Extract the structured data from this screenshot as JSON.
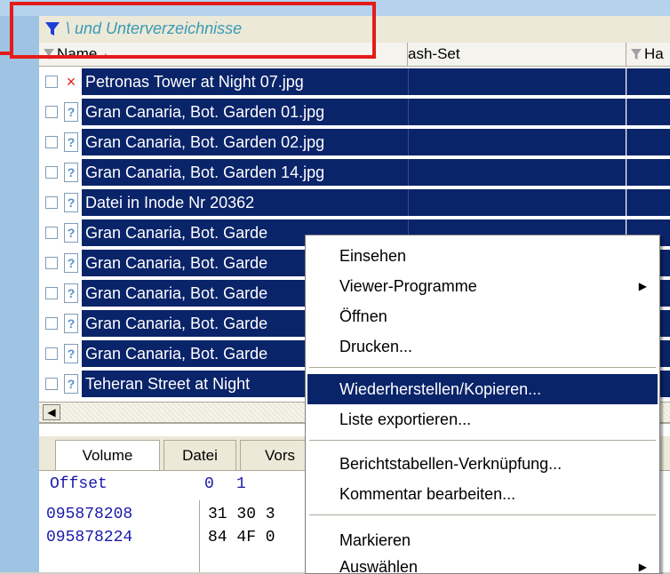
{
  "filter_bar": {
    "text": "\\ und Unterverzeichnisse"
  },
  "columns": {
    "name": "Name",
    "hash_set": "ash-Set",
    "hash": "Ha"
  },
  "rows": [
    {
      "name": "Petronas Tower at Night 07.jpg",
      "icon": "deleted-x-icon",
      "glyph": "×"
    },
    {
      "name": "Gran Canaria, Bot. Garden 01.jpg",
      "icon": "unknown-file-icon",
      "glyph": "?"
    },
    {
      "name": "Gran Canaria, Bot. Garden 02.jpg",
      "icon": "unknown-file-icon",
      "glyph": "?"
    },
    {
      "name": "Gran Canaria, Bot. Garden 14.jpg",
      "icon": "unknown-file-icon",
      "glyph": "?"
    },
    {
      "name": "Datei in Inode Nr 20362",
      "icon": "unknown-file-icon",
      "glyph": "?"
    },
    {
      "name": "Gran Canaria, Bot. Garde",
      "icon": "unknown-file-icon",
      "glyph": "?"
    },
    {
      "name": "Gran Canaria, Bot. Garde",
      "icon": "unknown-file-icon",
      "glyph": "?"
    },
    {
      "name": "Gran Canaria, Bot. Garde",
      "icon": "unknown-file-icon",
      "glyph": "?"
    },
    {
      "name": "Gran Canaria, Bot. Garde",
      "icon": "unknown-file-icon",
      "glyph": "?"
    },
    {
      "name": "Gran Canaria, Bot. Garde",
      "icon": "unknown-file-icon",
      "glyph": "?"
    },
    {
      "name": "Teheran Street at Night",
      "icon": "unknown-file-icon",
      "glyph": "?"
    }
  ],
  "scroll": {
    "left_arrow": "◀"
  },
  "tabs": {
    "volume": "Volume",
    "datei": "Datei",
    "vors": "Vors"
  },
  "hex": {
    "offset_label": "Offset",
    "col0": "0",
    "col1": "1",
    "rows": [
      {
        "offset": "095878208",
        "bytes": "31 30 3"
      },
      {
        "offset": "095878224",
        "bytes": "84 4F 0"
      }
    ]
  },
  "context_menu": {
    "items": {
      "einsehen": "Einsehen",
      "viewer": "Viewer-Programme",
      "oeffnen": "Öffnen",
      "drucken": "Drucken...",
      "wiederherstellen": "Wiederherstellen/Kopieren...",
      "liste": "Liste exportieren...",
      "bericht": "Berichtstabellen-Verknüpfung...",
      "kommentar": "Kommentar bearbeiten...",
      "markieren": "Markieren",
      "auswaehlen": "Auswählen"
    },
    "submenu_arrow": "▶"
  },
  "colors": {
    "selection": "#0a246a",
    "filter_text": "#3a9ab5",
    "highlight_box": "#e41b1b",
    "filter_icon": "#1a3fd6"
  }
}
